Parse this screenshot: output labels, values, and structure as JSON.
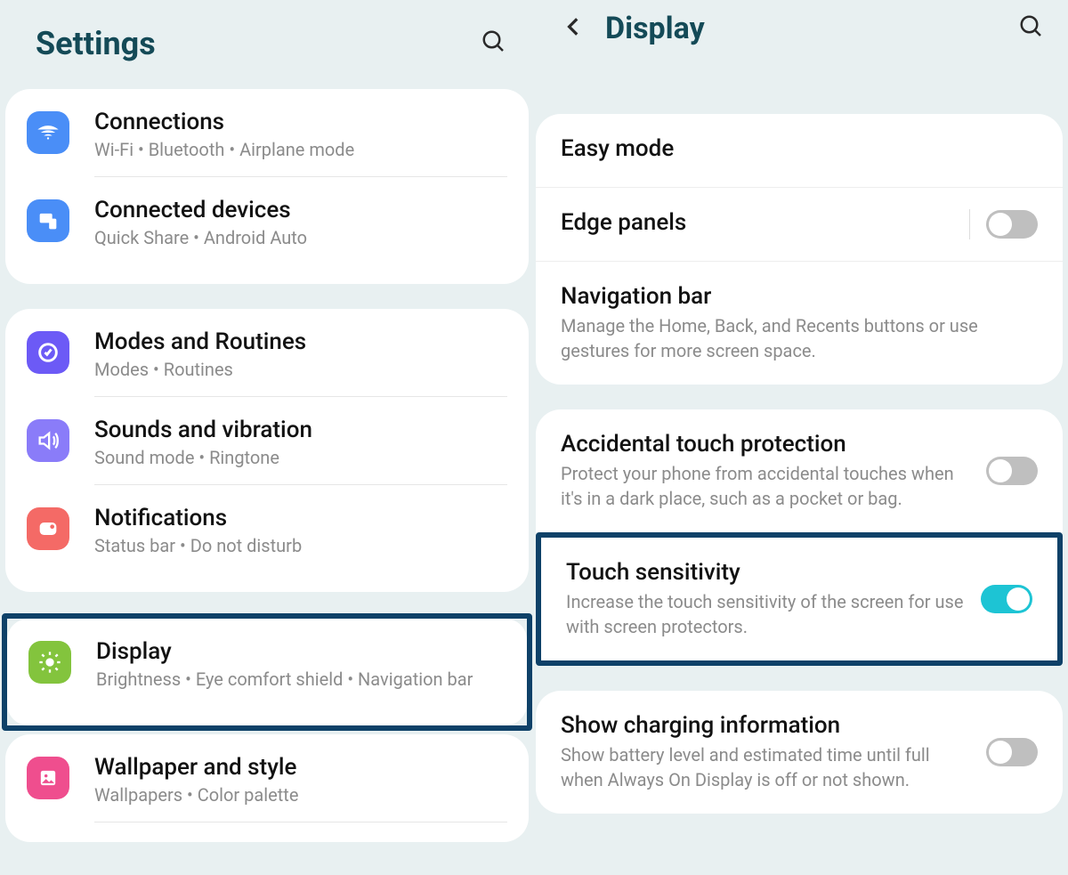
{
  "left": {
    "title": "Settings",
    "groups": [
      {
        "items": [
          {
            "title": "Connections",
            "sub": "Wi-Fi • Bluetooth • Airplane mode",
            "iconColor": "#4a8ef7"
          },
          {
            "title": "Connected devices",
            "sub": "Quick Share • Android Auto",
            "iconColor": "#4a8ef7"
          }
        ]
      },
      {
        "items": [
          {
            "title": "Modes and Routines",
            "sub": "Modes • Routines",
            "iconColor": "#6c5af6"
          },
          {
            "title": "Sounds and vibration",
            "sub": "Sound mode • Ringtone",
            "iconColor": "#8a7cf9"
          },
          {
            "title": "Notifications",
            "sub": "Status bar • Do not disturb",
            "iconColor": "#f46a66"
          }
        ]
      }
    ],
    "highlighted": {
      "title": "Display",
      "sub": "Brightness • Eye comfort shield • Navigation bar",
      "iconColor": "#83c43d"
    },
    "after": {
      "title": "Wallpaper and style",
      "sub": "Wallpapers • Color palette",
      "iconColor": "#ef4e8e"
    }
  },
  "right": {
    "title": "Display",
    "group1": [
      {
        "title": "Easy mode"
      },
      {
        "title": "Edge panels",
        "toggle": "off",
        "vsep": true
      },
      {
        "title": "Navigation bar",
        "sub": "Manage the Home, Back, and Recents buttons or use gestures for more screen space."
      }
    ],
    "accidental": {
      "title": "Accidental touch protection",
      "sub": "Protect your phone from accidental touches when it's in a dark place, such as a pocket or bag.",
      "toggle": "off"
    },
    "highlighted": {
      "title": "Touch sensitivity",
      "sub": "Increase the touch sensitivity of the screen for use with screen protectors.",
      "toggle": "on"
    },
    "charging": {
      "title": "Show charging information",
      "sub": "Show battery level and estimated time until full when Always On Display is off or not shown.",
      "toggle": "off"
    }
  }
}
